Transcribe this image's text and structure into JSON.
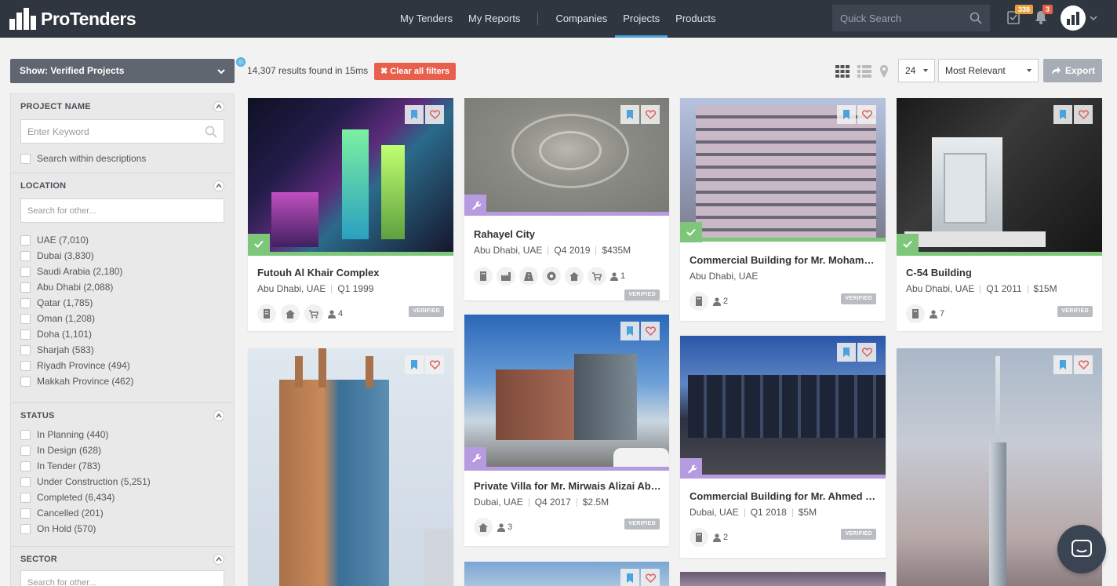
{
  "app": {
    "brand": "ProTenders"
  },
  "nav": {
    "items": [
      "My Tenders",
      "My Reports",
      "Companies",
      "Projects",
      "Products"
    ],
    "active": "Projects"
  },
  "search": {
    "placeholder": "Quick Search"
  },
  "notifications": {
    "tasks_count": "338",
    "alerts_count": "3"
  },
  "colors": {
    "brand_dark": "#2f3640",
    "accent": "#4aa3df",
    "verified": "#7dc67a",
    "planning": "#b79be0",
    "danger": "#e8604c"
  },
  "sidebar": {
    "show_select": "Show: Verified Projects",
    "project_name": {
      "title": "PROJECT NAME",
      "keyword_placeholder": "Enter Keyword",
      "search_descriptions": "Search within descriptions"
    },
    "location": {
      "title": "LOCATION",
      "placeholder": "Search for other...",
      "items": [
        "UAE (7,010)",
        "Dubai (3,830)",
        "Saudi Arabia (2,180)",
        "Abu Dhabi (2,088)",
        "Qatar (1,785)",
        "Oman (1,208)",
        "Doha (1,101)",
        "Sharjah (583)",
        "Riyadh Province (494)",
        "Makkah Province (462)"
      ]
    },
    "status": {
      "title": "STATUS",
      "items": [
        "In Planning (440)",
        "In Design (628)",
        "In Tender (783)",
        "Under Construction (5,251)",
        "Completed (6,434)",
        "Cancelled (201)",
        "On Hold (570)"
      ]
    },
    "sector": {
      "title": "SECTOR",
      "placeholder": "Search for other..."
    }
  },
  "toolbar": {
    "results": "14,307 results found in 15ms",
    "clear_filters": "Clear all filters",
    "per_page": "24",
    "sort": "Most Relevant",
    "export": "Export"
  },
  "cards": [
    {
      "title": "Futouh Al Khair Complex",
      "location": "Abu Dhabi, UAE",
      "quarter": "Q1 1999",
      "value": "",
      "count": "4",
      "badge": "VERIFIED",
      "status": "verified"
    },
    {
      "title": "Rahayel City",
      "location": "Abu Dhabi, UAE",
      "quarter": "Q4 2019",
      "value": "$435M",
      "count": "1",
      "badge": "VERIFIED",
      "status": "planning"
    },
    {
      "title": "Commercial Building for Mr. Mohammed...",
      "location": "Abu Dhabi, UAE",
      "quarter": "",
      "value": "",
      "count": "2",
      "badge": "VERIFIED",
      "status": "verified"
    },
    {
      "title": "C-54 Building",
      "location": "Abu Dhabi, UAE",
      "quarter": "Q1 2011",
      "value": "$15M",
      "count": "7",
      "badge": "VERIFIED",
      "status": "verified"
    },
    {
      "title": "Private Villa for Mr. Mirwais Alizai Abdu...",
      "location": "Dubai, UAE",
      "quarter": "Q4 2017",
      "value": "$2.5M",
      "count": "3",
      "badge": "VERIFIED",
      "status": "planning"
    },
    {
      "title": "Commercial Building for Mr. Ahmed Mo...",
      "location": "Dubai, UAE",
      "quarter": "Q1 2018",
      "value": "$5M",
      "count": "2",
      "badge": "VERIFIED",
      "status": "planning"
    }
  ]
}
